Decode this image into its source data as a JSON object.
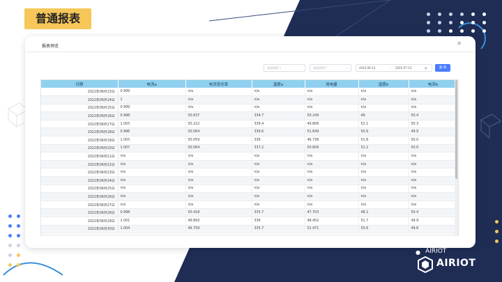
{
  "slide": {
    "title": "普通报表",
    "logo_text": "AIRIOT",
    "wechat_label": "AIRIOT"
  },
  "modal": {
    "title": "报表预览",
    "close_icon": "close-icon"
  },
  "filters": {
    "dept_placeholder": "请选择部门",
    "user_placeholder": "请选择用户",
    "start_date": "2022-06-13",
    "date_separator": "-",
    "end_date": "2022-07-13",
    "query_label": "查 询"
  },
  "table": {
    "headers": [
      "日期",
      "电流a",
      "电流变化率",
      "温度a",
      "用电量",
      "温度b",
      "电流b"
    ],
    "rows": [
      [
        "2022年06月13日",
        "0.999",
        "n/a",
        "n/a",
        "n/a",
        "n/a",
        "n/a"
      ],
      [
        "2022年06月14日",
        "1",
        "n/a",
        "n/a",
        "n/a",
        "n/a",
        "n/a"
      ],
      [
        "2022年06月15日",
        "0.999",
        "n/a",
        "n/a",
        "n/a",
        "n/a",
        "n/a"
      ],
      [
        "2022年06月16日",
        "0.998",
        "50.637",
        "334.7",
        "50.249",
        "49",
        "50.4"
      ],
      [
        "2022年06月17日",
        "1.003",
        "50.222",
        "336.4",
        "49.806",
        "52.1",
        "50.3"
      ],
      [
        "2022年06月18日",
        "0.996",
        "50.064",
        "336.6",
        "51.649",
        "50.9",
        "49.9"
      ],
      [
        "2022年06月19日",
        "1.003",
        "50.059",
        "336",
        "46.736",
        "51.8",
        "50.0"
      ],
      [
        "2022年06月20日",
        "1.007",
        "50.064",
        "337.2",
        "50.609",
        "51.2",
        "50.0"
      ],
      [
        "2022年06月21日",
        "n/a",
        "n/a",
        "n/a",
        "n/a",
        "n/a",
        "n/a"
      ],
      [
        "2022年06月22日",
        "n/a",
        "n/a",
        "n/a",
        "n/a",
        "n/a",
        "n/a"
      ],
      [
        "2022年06月23日",
        "n/a",
        "n/a",
        "n/a",
        "n/a",
        "n/a",
        "n/a"
      ],
      [
        "2022年06月24日",
        "n/a",
        "n/a",
        "n/a",
        "n/a",
        "n/a",
        "n/a"
      ],
      [
        "2022年06月25日",
        "n/a",
        "n/a",
        "n/a",
        "n/a",
        "n/a",
        "n/a"
      ],
      [
        "2022年06月26日",
        "n/a",
        "n/a",
        "n/a",
        "n/a",
        "n/a",
        "n/a"
      ],
      [
        "2022年06月27日",
        "n/a",
        "n/a",
        "n/a",
        "n/a",
        "n/a",
        "n/a"
      ],
      [
        "2022年06月28日",
        "0.998",
        "50.418",
        "335.7",
        "47.703",
        "48.2",
        "50.4"
      ],
      [
        "2022年06月29日",
        "1.001",
        "49.893",
        "336",
        "48.452",
        "51.7",
        "49.9"
      ],
      [
        "2022年06月30日",
        "1.004",
        "49.759",
        "335.7",
        "52.471",
        "50.6",
        "49.8"
      ]
    ]
  },
  "colors": {
    "navy": "#1f2d55",
    "accent_yellow": "#f7c75a",
    "header_blue": "#8fd0ef",
    "query_blue": "#4a7dff"
  }
}
